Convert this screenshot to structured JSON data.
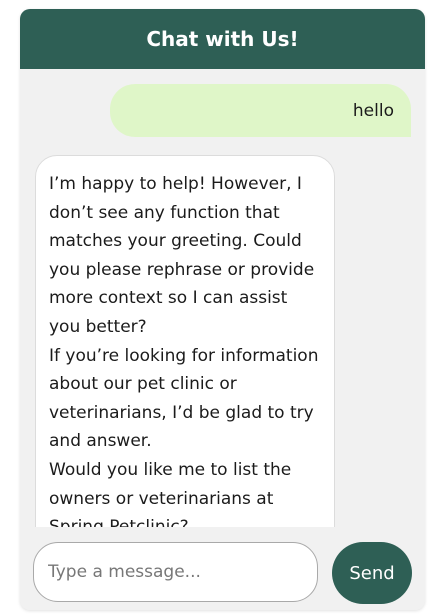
{
  "header": {
    "title": "Chat with Us!"
  },
  "messages": {
    "user": {
      "text": "hello"
    },
    "bot": {
      "paragraphs": [
        "I’m happy to help! However, I don’t see any function that matches your greeting. Could you please rephrase or provide more context so I can assist you better?",
        "If you’re looking for information about our pet clinic or veterinarians, I’d be glad to try and answer.",
        "Would you like me to list the owners or veterinarians at Spring Petclinic?"
      ]
    }
  },
  "composer": {
    "placeholder": "Type a message...",
    "value": "",
    "send_label": "Send"
  },
  "colors": {
    "primary": "#2e5f55",
    "user_bubble": "#dff6c8",
    "panel": "#f1f1f1"
  }
}
